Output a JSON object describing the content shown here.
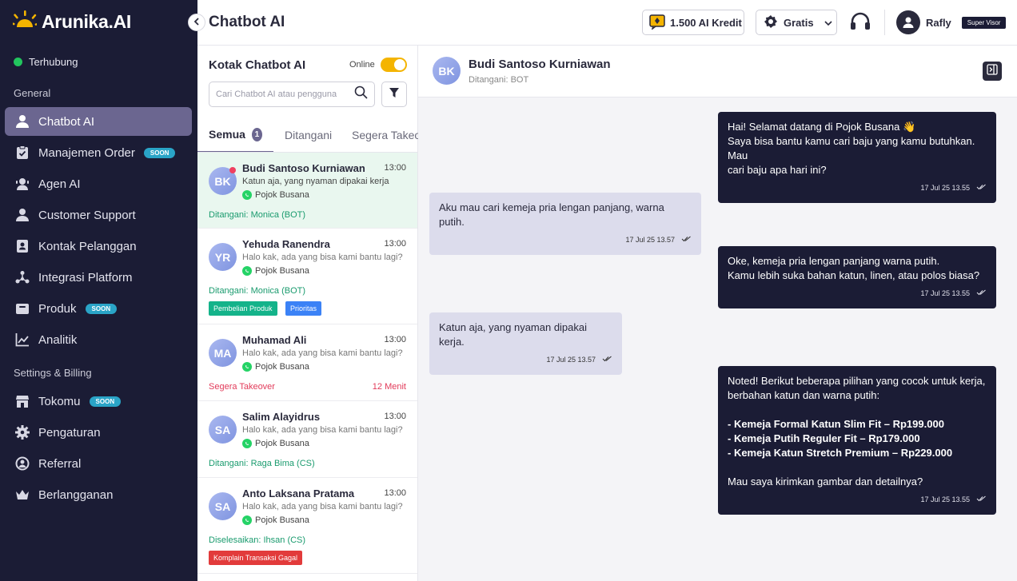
{
  "brand": {
    "name": "Arunika.AI",
    "accent": "#f4b400",
    "sidebar_bg": "#1b1c35"
  },
  "connection": {
    "status": "Terhubung"
  },
  "sidebar": {
    "general_title": "General",
    "general_items": [
      {
        "label": "Chatbot AI",
        "icon": "person-icon",
        "active": true
      },
      {
        "label": "Manajemen Order",
        "icon": "clipboard-icon",
        "badge": "SOON"
      },
      {
        "label": "Agen AI",
        "icon": "agent-icon"
      },
      {
        "label": "Customer Support",
        "icon": "support-person-icon"
      },
      {
        "label": "Kontak Pelanggan",
        "icon": "contact-book-icon"
      },
      {
        "label": "Integrasi Platform",
        "icon": "integration-icon"
      },
      {
        "label": "Produk",
        "icon": "product-box-icon",
        "badge": "SOON"
      },
      {
        "label": "Analitik",
        "icon": "chart-icon"
      }
    ],
    "settings_title": "Settings & Billing",
    "settings_items": [
      {
        "label": "Tokomu",
        "icon": "store-icon",
        "badge": "SOON"
      },
      {
        "label": "Pengaturan",
        "icon": "gear-icon"
      },
      {
        "label": "Referral",
        "icon": "referral-icon"
      },
      {
        "label": "Berlangganan",
        "icon": "crown-icon"
      }
    ]
  },
  "header": {
    "title": "Chatbot AI",
    "credits": "1.500 AI Kredit",
    "plan": "Gratis",
    "user_name": "Rafly",
    "user_role": "Super Visor"
  },
  "inbox": {
    "title": "Kotak Chatbot AI",
    "online_label": "Online",
    "online": true,
    "search_placeholder": "Cari Chatbot AI atau pengguna",
    "tabs": [
      {
        "label": "Semua",
        "count": "1",
        "active": true
      },
      {
        "label": "Ditangani"
      },
      {
        "label": "Segera Takeover"
      }
    ],
    "conversations": [
      {
        "initials": "BK",
        "name": "Budi Santoso Kurniawan",
        "time": "13:00",
        "preview": "Katun aja, yang nyaman dipakai kerja",
        "channel": "Pojok Busana",
        "handler": "Ditangani: Monica (BOT)",
        "unread": true,
        "selected": true
      },
      {
        "initials": "YR",
        "name": "Yehuda Ranendra",
        "time": "13:00",
        "preview": "Halo kak, ada yang bisa kami bantu lagi?",
        "channel": "Pojok Busana",
        "handler": "Ditangani: Monica (BOT)",
        "tags": [
          {
            "label": "Pembelian Produk",
            "color": "#14b38a"
          },
          {
            "label": "Prioritas",
            "color": "#3b82f6"
          }
        ]
      },
      {
        "initials": "MA",
        "name": "Muhamad Ali",
        "time": "13:00",
        "preview": "Halo kak, ada yang bisa kami bantu lagi?",
        "channel": "Pojok Busana",
        "handler": "Segera Takeover",
        "handler_right": "12 Menit",
        "urgent": true
      },
      {
        "initials": "SA",
        "name": "Salim Alayidrus",
        "time": "13:00",
        "preview": "Halo kak, ada yang bisa kami bantu lagi?",
        "channel": "Pojok Busana",
        "handler": "Ditangani: Raga Bima (CS)"
      },
      {
        "initials": "SA",
        "name": "Anto Laksana Pratama",
        "time": "13:00",
        "preview": "Halo kak, ada yang bisa kami bantu lagi?",
        "channel": "Pojok Busana",
        "handler": "Diselesaikan: Ihsan (CS)",
        "tags": [
          {
            "label": "Komplain Transaksi Gagal",
            "color": "#e23b3b"
          }
        ]
      }
    ]
  },
  "chat": {
    "initials": "BK",
    "name": "Budi Santoso Kurniawan",
    "subtitle": "Ditangani: BOT",
    "messages": [
      {
        "direction": "out",
        "lines": [
          "Hai! Selamat datang di Pojok Busana 👋",
          "Saya bisa bantu kamu cari baju yang kamu butuhkan. Mau",
          "cari baju apa hari ini?"
        ],
        "time": "17 Jul 25 13.55"
      },
      {
        "direction": "in",
        "lines": [
          "Aku mau cari kemeja pria lengan panjang, warna putih."
        ],
        "time": "17 Jul 25 13.57"
      },
      {
        "direction": "out",
        "lines": [
          "Oke, kemeja pria lengan panjang warna putih.",
          "Kamu lebih suka bahan katun, linen, atau polos biasa?"
        ],
        "time": "17 Jul 25 13.55"
      },
      {
        "direction": "in",
        "lines": [
          "Katun aja, yang nyaman dipakai kerja."
        ],
        "time": "17 Jul 25 13.57"
      },
      {
        "direction": "out",
        "lines": [
          "Noted! Berikut beberapa pilihan yang cocok untuk kerja,",
          "berbahan katun dan warna putih:",
          "",
          "- Kemeja Formal Katun Slim Fit – Rp199.000",
          "- Kemeja Putih Reguler Fit – Rp179.000",
          "- Kemeja Katun Stretch Premium – Rp229.000",
          "",
          "Mau saya kirimkan gambar dan detailnya?"
        ],
        "bold_lines": [
          3,
          4,
          5
        ],
        "time": "17 Jul 25 13.55"
      }
    ]
  }
}
